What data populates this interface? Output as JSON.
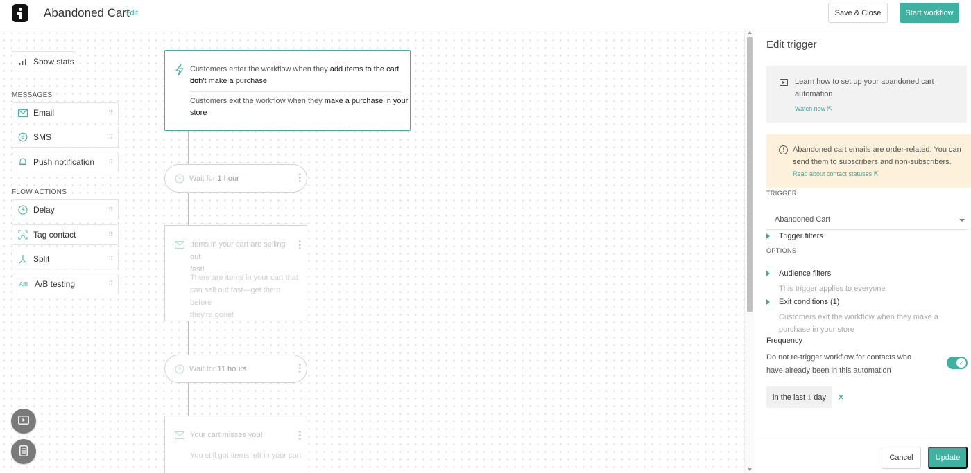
{
  "header": {
    "title": "Abandoned Cart",
    "edit_label": "Edit",
    "save_close_label": "Save & Close",
    "start_label": "Start workflow"
  },
  "sidebar": {
    "show_stats": "Show stats",
    "messages_heading": "MESSAGES",
    "messages": [
      {
        "label": "Email",
        "icon": "envelope-icon"
      },
      {
        "label": "SMS",
        "icon": "chat-bubble-icon"
      },
      {
        "label": "Push notification",
        "icon": "bell-icon"
      }
    ],
    "flow_heading": "FLOW ACTIONS",
    "flow_actions": [
      {
        "label": "Delay",
        "icon": "clock-icon"
      },
      {
        "label": "Tag contact",
        "icon": "tag-icon"
      },
      {
        "label": "Split",
        "icon": "split-icon"
      },
      {
        "label": "A/B testing",
        "icon": "ab-icon"
      }
    ]
  },
  "workflow": {
    "trigger": {
      "enter_prefix": "Customers enter the workflow when they ",
      "enter_bold_1": "add items to the cart but",
      "enter_bold_2": "don't make a purchase",
      "exit_prefix": "Customers exit the workflow when they ",
      "exit_bold_1": "make a purchase in your",
      "exit_bold_2": "store"
    },
    "wait_1": {
      "prefix": "Wait for ",
      "value": "1 hour"
    },
    "email_1": {
      "subject_1": "Items in your cart are selling out",
      "subject_2": "fast!",
      "body_1": "There are items in your cart that",
      "body_2": "can sell out fast—get them before",
      "body_3": "they're gone!"
    },
    "wait_2": {
      "prefix": "Wait for ",
      "value": "11 hours"
    },
    "email_2": {
      "subject_1": "Your cart misses you!",
      "body_1": "You still got items left in your cart"
    }
  },
  "panel": {
    "title": "Edit trigger",
    "info": {
      "text": "Learn how to set up your abandoned cart automation",
      "link": "Watch now"
    },
    "warning": {
      "text": "Abandoned cart emails are order-related. You can send them to subscribers and non-subscribers.",
      "link": "Read about contact statuses"
    },
    "trigger_label": "TRIGGER",
    "trigger_value": "Abandoned Cart",
    "trigger_filters": "Trigger filters",
    "options_label": "OPTIONS",
    "audience_filters": "Audience filters",
    "audience_desc": "This trigger applies to everyone",
    "exit_conditions": "Exit conditions (1)",
    "exit_desc": "Customers exit the workflow when they make a purchase in your store",
    "frequency_title": "Frequency",
    "frequency_desc": "Do not re-trigger workflow for contacts who have already been in this automation",
    "frequency_enabled": true,
    "chip": {
      "prefix": "in the last",
      "value": "1",
      "unit": "day"
    },
    "cancel_label": "Cancel",
    "update_label": "Update"
  },
  "colors": {
    "accent": "#3fb1a1",
    "warning_bg": "#fdf1dc",
    "info_bg": "#f2f2f2"
  }
}
